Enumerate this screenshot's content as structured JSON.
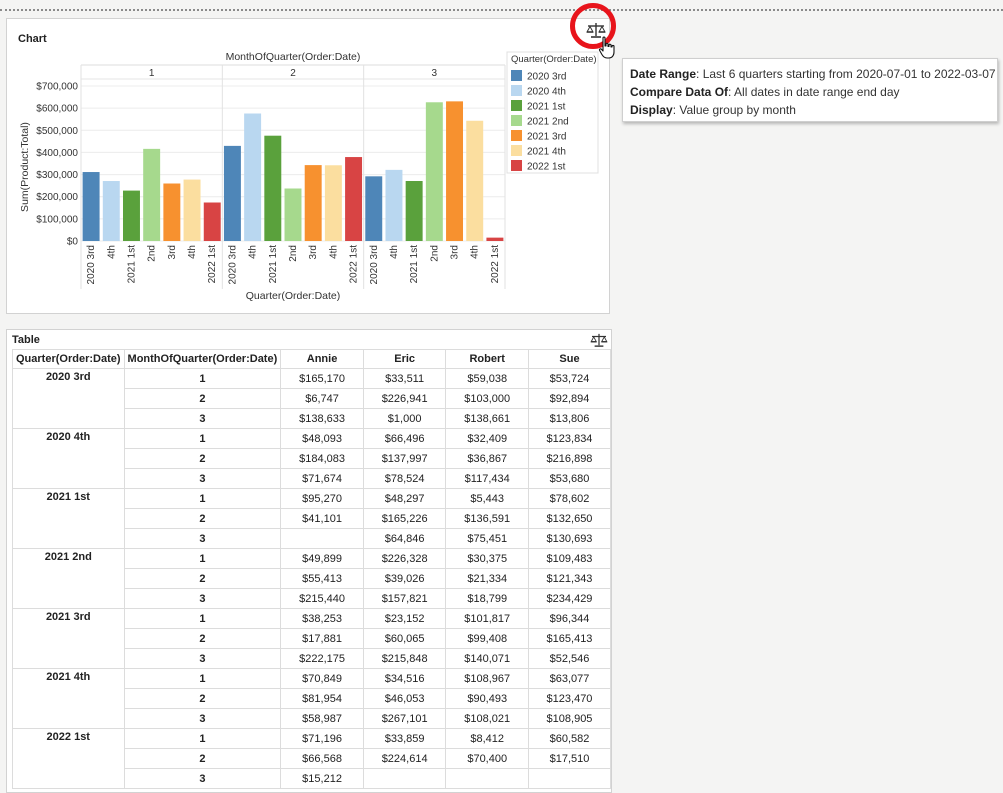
{
  "chart_panel": {
    "title": "Chart"
  },
  "table_panel": {
    "title": "Table"
  },
  "tooltip": {
    "rows": [
      {
        "label": "Date Range",
        "value": "Last 6 quarters starting from 2020-07-01 to 2022-03-07"
      },
      {
        "label": "Compare Data Of",
        "value": "All dates in date range end day"
      },
      {
        "label": "Display",
        "value": "Value group by month"
      }
    ]
  },
  "icons": {
    "compare": "balance-scale-icon",
    "cursor": "hand-pointer-icon"
  },
  "colors": {
    "highlight": "#e8141b"
  },
  "chart_data": {
    "type": "bar",
    "title": "MonthOfQuarter(Order:Date)",
    "xlabel": "Quarter(Order:Date)",
    "ylabel": "Sum(Product:Total)",
    "ylim": [
      0,
      750000
    ],
    "yticks": [
      0,
      100000,
      200000,
      300000,
      400000,
      500000,
      600000,
      700000
    ],
    "ytick_labels": [
      "$0",
      "$100,000",
      "$200,000",
      "$300,000",
      "$400,000",
      "$500,000",
      "$600,000",
      "$700,000"
    ],
    "grid": true,
    "legend_title": "Quarter(Order:Date)",
    "legend_position": "right",
    "series": [
      {
        "name": "2020 3rd",
        "color": "#4e86b8"
      },
      {
        "name": "2020 4th",
        "color": "#b9d7f0"
      },
      {
        "name": "2021 1st",
        "color": "#5aa13c"
      },
      {
        "name": "2021 2nd",
        "color": "#a6d98d"
      },
      {
        "name": "2021 3rd",
        "color": "#f7912f"
      },
      {
        "name": "2021 4th",
        "color": "#fbde9f"
      },
      {
        "name": "2022 1st",
        "color": "#d84444"
      }
    ],
    "groups": [
      {
        "label": "1",
        "categories": [
          "2020 3rd",
          "4th",
          "2021 1st",
          "2nd",
          "3rd",
          "4th",
          "2022 1st"
        ],
        "values": [
          311443,
          270832,
          227612,
          416085,
          259639,
          277409,
          173849
        ]
      },
      {
        "label": "2",
        "categories": [
          "2020 3rd",
          "4th",
          "2021 1st",
          "2nd",
          "3rd",
          "4th",
          "2022 1st"
        ],
        "values": [
          429582,
          575815,
          475568,
          237116,
          342767,
          342010,
          379092
        ]
      },
      {
        "label": "3",
        "categories": [
          "2020 3rd",
          "4th",
          "2021 1st",
          "2nd",
          "3rd",
          "4th",
          "2022 1st"
        ],
        "values": [
          292100,
          321240,
          270990,
          626489,
          630640,
          543014,
          15212
        ]
      }
    ]
  },
  "table": {
    "headers": [
      "Quarter(Order:Date)",
      "MonthOfQuarter(Order:Date)",
      "Annie",
      "Eric",
      "Robert",
      "Sue"
    ],
    "groups": [
      {
        "quarter": "2020 3rd",
        "rows": [
          {
            "month": "1",
            "values": [
              "$165,170",
              "$33,511",
              "$59,038",
              "$53,724"
            ]
          },
          {
            "month": "2",
            "values": [
              "$6,747",
              "$226,941",
              "$103,000",
              "$92,894"
            ]
          },
          {
            "month": "3",
            "values": [
              "$138,633",
              "$1,000",
              "$138,661",
              "$13,806"
            ]
          }
        ]
      },
      {
        "quarter": "2020 4th",
        "rows": [
          {
            "month": "1",
            "values": [
              "$48,093",
              "$66,496",
              "$32,409",
              "$123,834"
            ]
          },
          {
            "month": "2",
            "values": [
              "$184,083",
              "$137,997",
              "$36,867",
              "$216,898"
            ]
          },
          {
            "month": "3",
            "values": [
              "$71,674",
              "$78,524",
              "$117,434",
              "$53,680"
            ]
          }
        ]
      },
      {
        "quarter": "2021 1st",
        "rows": [
          {
            "month": "1",
            "values": [
              "$95,270",
              "$48,297",
              "$5,443",
              "$78,602"
            ]
          },
          {
            "month": "2",
            "values": [
              "$41,101",
              "$165,226",
              "$136,591",
              "$132,650"
            ]
          },
          {
            "month": "3",
            "values": [
              "",
              "$64,846",
              "$75,451",
              "$130,693"
            ]
          }
        ]
      },
      {
        "quarter": "2021 2nd",
        "rows": [
          {
            "month": "1",
            "values": [
              "$49,899",
              "$226,328",
              "$30,375",
              "$109,483"
            ]
          },
          {
            "month": "2",
            "values": [
              "$55,413",
              "$39,026",
              "$21,334",
              "$121,343"
            ]
          },
          {
            "month": "3",
            "values": [
              "$215,440",
              "$157,821",
              "$18,799",
              "$234,429"
            ]
          }
        ]
      },
      {
        "quarter": "2021 3rd",
        "rows": [
          {
            "month": "1",
            "values": [
              "$38,253",
              "$23,152",
              "$101,817",
              "$96,344"
            ]
          },
          {
            "month": "2",
            "values": [
              "$17,881",
              "$60,065",
              "$99,408",
              "$165,413"
            ]
          },
          {
            "month": "3",
            "values": [
              "$222,175",
              "$215,848",
              "$140,071",
              "$52,546"
            ]
          }
        ]
      },
      {
        "quarter": "2021 4th",
        "rows": [
          {
            "month": "1",
            "values": [
              "$70,849",
              "$34,516",
              "$108,967",
              "$63,077"
            ]
          },
          {
            "month": "2",
            "values": [
              "$81,954",
              "$46,053",
              "$90,493",
              "$123,470"
            ]
          },
          {
            "month": "3",
            "values": [
              "$58,987",
              "$267,101",
              "$108,021",
              "$108,905"
            ]
          }
        ]
      },
      {
        "quarter": "2022 1st",
        "rows": [
          {
            "month": "1",
            "values": [
              "$71,196",
              "$33,859",
              "$8,412",
              "$60,582"
            ]
          },
          {
            "month": "2",
            "values": [
              "$66,568",
              "$224,614",
              "$70,400",
              "$17,510"
            ]
          },
          {
            "month": "3",
            "values": [
              "$15,212",
              "",
              "",
              ""
            ]
          }
        ]
      }
    ]
  }
}
